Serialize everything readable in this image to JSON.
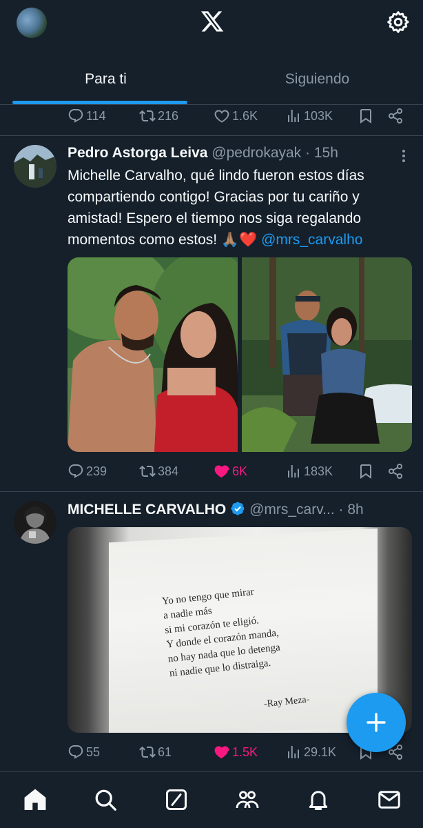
{
  "header": {
    "logo": "x-logo-icon",
    "settings_icon": "gear-icon",
    "avatar": "profile-avatar"
  },
  "tabs": [
    {
      "label": "Para ti",
      "active": true
    },
    {
      "label": "Siguiendo",
      "active": false
    }
  ],
  "prev_post": {
    "replies": "114",
    "reposts": "216",
    "likes": "1.6K",
    "views": "103K"
  },
  "post1": {
    "name": "Pedro Astorga Leiva",
    "handle": "@pedrokayak",
    "dot": "·",
    "time": "15h",
    "text_lines": [
      "Michelle Carvalho, qué lindo fueron estos días",
      "compartiendo contigo! Gracias por tu cariño y",
      "amistad! Espero el tiempo nos siga regalando",
      "momentos como estos! 🙏🏽❤️"
    ],
    "mention": "@mrs_carvalho",
    "media": [
      "photo-couple-riverside",
      "photo-couple-waterfall"
    ],
    "replies": "239",
    "reposts": "384",
    "likes": "6K",
    "views": "183K",
    "liked": true
  },
  "post2": {
    "name": "MICHELLE CARVALHO",
    "verified": true,
    "handle": "@mrs_carv...",
    "dot": "·",
    "time": "8h",
    "image_text": {
      "lines": [
        "Yo no tengo que mirar",
        "a nadie más",
        "si mi corazón te eligió.",
        "Y donde el corazón manda,",
        "no hay nada que lo detenga",
        "ni nadie que lo distraiga."
      ],
      "author": "-Ray Meza-"
    },
    "replies": "55",
    "reposts": "61",
    "likes": "1.5K",
    "views": "29.1K",
    "liked": true
  },
  "fab": {
    "icon": "plus-icon"
  },
  "bottom_nav": [
    "home-icon",
    "search-icon",
    "grok-icon",
    "communities-icon",
    "notifications-icon",
    "messages-icon"
  ],
  "colors": {
    "background": "#15202b",
    "accent": "#1d9bf0",
    "like": "#f91880",
    "muted": "#8b98a5",
    "divider": "#38444d"
  }
}
